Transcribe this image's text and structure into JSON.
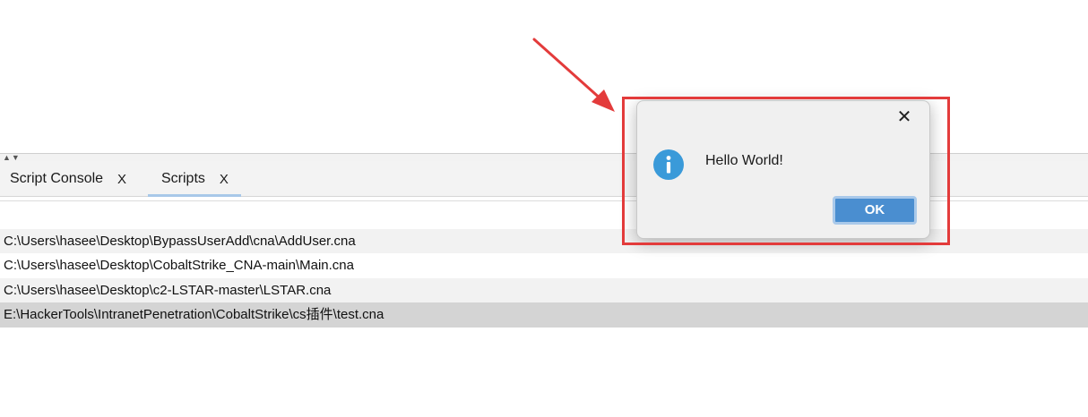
{
  "tabs": [
    {
      "label": "Script Console",
      "close": "X"
    },
    {
      "label": "Scripts",
      "close": "X"
    }
  ],
  "scripts": [
    "C:\\Users\\hasee\\Desktop\\BypassUserAdd\\cna\\AddUser.cna",
    "C:\\Users\\hasee\\Desktop\\CobaltStrike_CNA-main\\Main.cna",
    "C:\\Users\\hasee\\Desktop\\c2-LSTAR-master\\LSTAR.cna",
    "E:\\HackerTools\\IntranetPenetration\\CobaltStrike\\cs插件\\test.cna"
  ],
  "dialog": {
    "close_glyph": "✕",
    "message": "Hello World!",
    "ok_label": "OK",
    "icon": "info-icon"
  },
  "splitter": {
    "arrows": "▲▼"
  },
  "colors": {
    "annotation": "#e33b3b",
    "ok_button": "#4a8ed0",
    "info_icon": "#3a9ad9",
    "selected_row": "#d4d4d4"
  }
}
